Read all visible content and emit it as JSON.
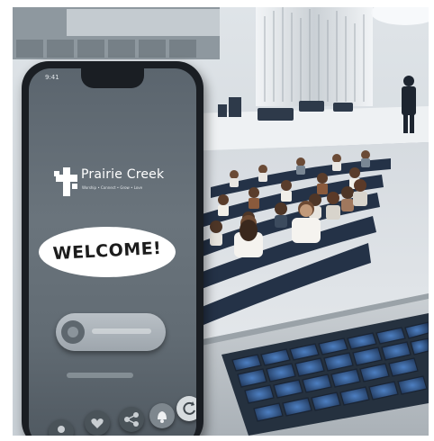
{
  "phone_app": {
    "brand": {
      "name": "Prairie Creek",
      "tagline": "Worship • Connect • Grow • Love"
    },
    "welcome_text": "WELCOME!",
    "status_time": "9:41"
  },
  "icons": [
    "cross-logo-icon",
    "tap-icon",
    "heart-icon",
    "share-icon",
    "bell-icon",
    "refresh-icon",
    "avatar-icon"
  ],
  "colors": {
    "phone_screen": "#636d75",
    "seats": "#243247",
    "laptop": "#bfc4c8",
    "keys": "#3d6aa8"
  }
}
